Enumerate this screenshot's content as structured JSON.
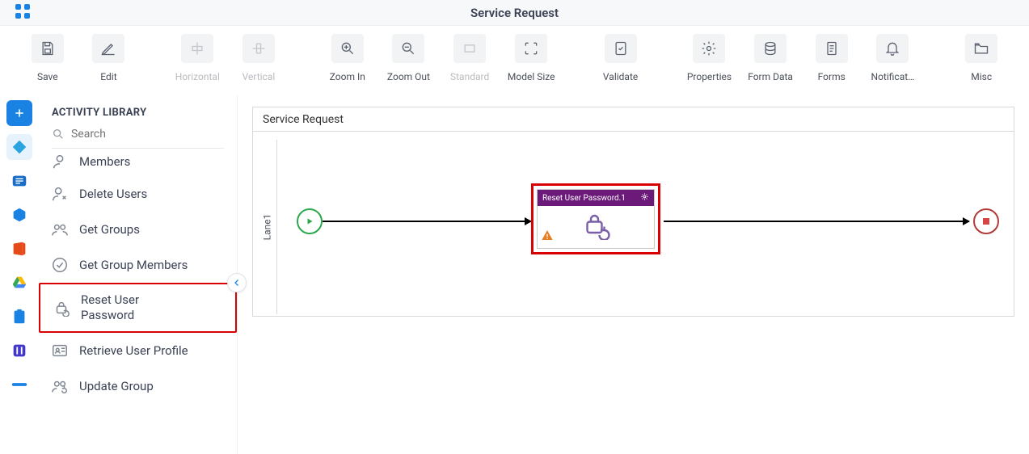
{
  "topbar": {
    "title": "Service Request"
  },
  "toolbar": {
    "items": [
      {
        "label": "Save",
        "icon": "save-icon",
        "disabled": false
      },
      {
        "label": "Edit",
        "icon": "edit-icon",
        "disabled": false
      },
      {
        "label": "Horizontal",
        "icon": "align-horizontal-icon",
        "disabled": true
      },
      {
        "label": "Vertical",
        "icon": "align-vertical-icon",
        "disabled": true
      },
      {
        "label": "Zoom In",
        "icon": "zoom-in-icon",
        "disabled": false
      },
      {
        "label": "Zoom Out",
        "icon": "zoom-out-icon",
        "disabled": false
      },
      {
        "label": "Standard",
        "icon": "zoom-standard-icon",
        "disabled": true
      },
      {
        "label": "Model Size",
        "icon": "model-size-icon",
        "disabled": false
      },
      {
        "label": "Validate",
        "icon": "validate-icon",
        "disabled": false
      },
      {
        "label": "Properties",
        "icon": "gear-icon",
        "disabled": false
      },
      {
        "label": "Form Data",
        "icon": "database-icon",
        "disabled": false
      },
      {
        "label": "Forms",
        "icon": "forms-icon",
        "disabled": false
      },
      {
        "label": "Notificat…",
        "icon": "bell-icon",
        "disabled": false
      },
      {
        "label": "Misc",
        "icon": "folder-icon",
        "disabled": false
      }
    ]
  },
  "iconrail": {
    "items": [
      {
        "name": "add",
        "icon": "plus-icon",
        "color": "#1a82e2"
      },
      {
        "name": "generic",
        "icon": "diamond-icon",
        "color": "#2aa3e0",
        "active": true
      },
      {
        "name": "exchange",
        "icon": "exchange-icon",
        "color": "#1a6dc7"
      },
      {
        "name": "box",
        "icon": "hexagon-icon",
        "color": "#1a82e2"
      },
      {
        "name": "office",
        "icon": "office-icon",
        "color": "#e64a19"
      },
      {
        "name": "drive",
        "icon": "drive-icon",
        "color": "#34a853"
      },
      {
        "name": "clipboard",
        "icon": "clipboard-icon",
        "color": "#1a82e2"
      },
      {
        "name": "indigo",
        "icon": "square-icon",
        "color": "#4338ca"
      },
      {
        "name": "more",
        "icon": "line-icon",
        "color": "#1a82e2"
      }
    ]
  },
  "sidebar": {
    "header": "ACTIVITY LIBRARY",
    "search_placeholder": "Search",
    "items": [
      {
        "label": "Members",
        "icon": "user-icon",
        "partial": true
      },
      {
        "label": "Delete Users",
        "icon": "delete-user-icon"
      },
      {
        "label": "Get Groups",
        "icon": "group-icon"
      },
      {
        "label": "Get Group Members",
        "icon": "check-circle-icon"
      },
      {
        "label": "Reset User Password",
        "icon": "lock-reset-icon",
        "highlight": true,
        "multiline": [
          "Reset User",
          "Password"
        ]
      },
      {
        "label": "Retrieve User Profile",
        "icon": "profile-card-icon"
      },
      {
        "label": "Update Group",
        "icon": "update-group-icon"
      }
    ]
  },
  "canvas": {
    "title": "Service Request",
    "lane": "Lane1",
    "activity": {
      "title": "Reset User Password.1"
    }
  }
}
